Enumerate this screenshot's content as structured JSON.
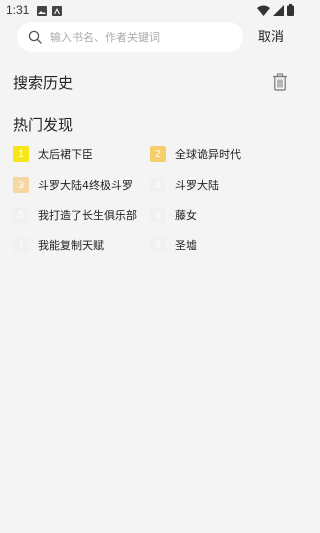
{
  "status_bar": {
    "time": "1:31"
  },
  "search": {
    "placeholder": "输入书名、作者关键词",
    "value": "",
    "cancel_label": "取消"
  },
  "history": {
    "title": "搜索历史"
  },
  "hot": {
    "title": "热门发现",
    "items": [
      {
        "rank": "1",
        "label": "太后裙下臣",
        "color": "#f7e61a"
      },
      {
        "rank": "2",
        "label": "全球诡异时代",
        "color": "#f6cf6a"
      },
      {
        "rank": "3",
        "label": "斗罗大陆4终极斗罗",
        "color": "#f5d8a1"
      },
      {
        "rank": "4",
        "label": "斗罗大陆",
        "color": "#f1f1f1"
      },
      {
        "rank": "5",
        "label": "我打造了长生俱乐部",
        "color": "#f1f1f1"
      },
      {
        "rank": "6",
        "label": "藤女",
        "color": "#f1f1f1"
      },
      {
        "rank": "7",
        "label": "我能复制天赋",
        "color": "#f1f1f1"
      },
      {
        "rank": "8",
        "label": "圣墟",
        "color": "#f1f1f1"
      }
    ]
  }
}
